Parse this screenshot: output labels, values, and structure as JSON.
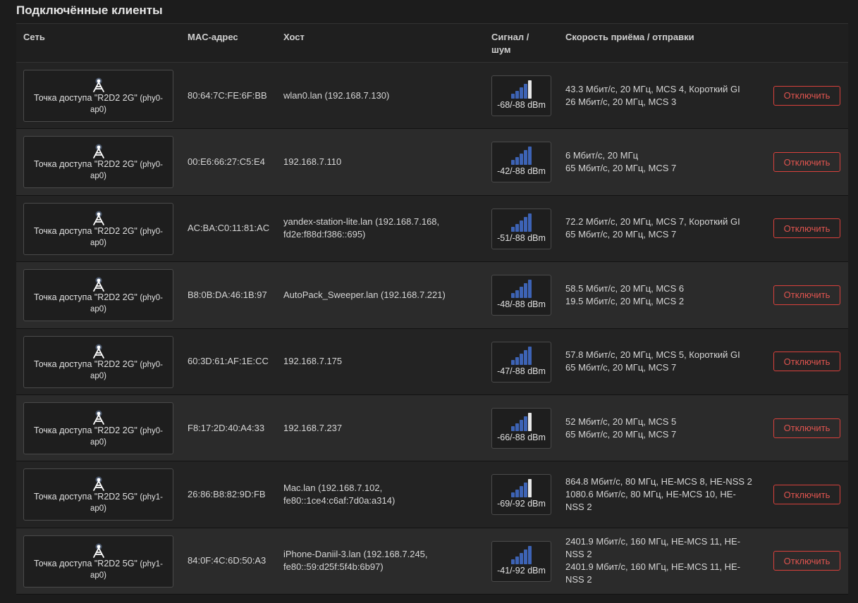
{
  "title": "Подключённые клиенты",
  "columns": {
    "network": "Сеть",
    "mac": "MAC-адрес",
    "host": "Хост",
    "signal_line1": "Сигнал /",
    "signal_line2": "шум",
    "rate": "Скорость приёма / отправки"
  },
  "colors": {
    "accent": "#d9413c",
    "signal_bar": "#3d63b5",
    "signal_bar_inactive": "#e8e8e8"
  },
  "rows": [
    {
      "net_line1": "Точка доступа \"R2D2 2G\"",
      "net_iface_a": "(phy0-",
      "net_iface_b": "ap0)",
      "mac": "80:64:7C:FE:6F:BB",
      "host_line1": "wlan0.lan (192.168.7.130)",
      "host_line2": "",
      "signal_bars_filled": 3,
      "signal": "-68/-88 dBm",
      "rate_line1": "43.3 Мбит/с, 20 МГц, MCS 4, Короткий GI",
      "rate_line2": "26 Мбит/с, 20 МГц, MCS 3",
      "rate_line3": "",
      "rate_line4": "",
      "button": "Отключить"
    },
    {
      "net_line1": "Точка доступа \"R2D2 2G\"",
      "net_iface_a": "(phy0-",
      "net_iface_b": "ap0)",
      "mac": "00:E6:66:27:C5:E4",
      "host_line1": "192.168.7.110",
      "host_line2": "",
      "signal_bars_filled": 4,
      "signal": "-42/-88 dBm",
      "rate_line1": "6 Мбит/с, 20 МГц",
      "rate_line2": "65 Мбит/с, 20 МГц, MCS 7",
      "rate_line3": "",
      "rate_line4": "",
      "button": "Отключить"
    },
    {
      "net_line1": "Точка доступа \"R2D2 2G\"",
      "net_iface_a": "(phy0-",
      "net_iface_b": "ap0)",
      "mac": "AC:BA:C0:11:81:AC",
      "host_line1": "yandex-station-lite.lan (192.168.7.168,",
      "host_line2": "fd2e:f88d:f386::695)",
      "signal_bars_filled": 4,
      "signal": "-51/-88 dBm",
      "rate_line1": "72.2 Мбит/с, 20 МГц, MCS 7, Короткий GI",
      "rate_line2": "65 Мбит/с, 20 МГц, MCS 7",
      "rate_line3": "",
      "rate_line4": "",
      "button": "Отключить"
    },
    {
      "net_line1": "Точка доступа \"R2D2 2G\"",
      "net_iface_a": "(phy0-",
      "net_iface_b": "ap0)",
      "mac": "B8:0B:DA:46:1B:97",
      "host_line1": "AutoPack_Sweeper.lan (192.168.7.221)",
      "host_line2": "",
      "signal_bars_filled": 4,
      "signal": "-48/-88 dBm",
      "rate_line1": "58.5 Мбит/с, 20 МГц, MCS 6",
      "rate_line2": "19.5 Мбит/с, 20 МГц, MCS 2",
      "rate_line3": "",
      "rate_line4": "",
      "button": "Отключить"
    },
    {
      "net_line1": "Точка доступа \"R2D2 2G\"",
      "net_iface_a": "(phy0-",
      "net_iface_b": "ap0)",
      "mac": "60:3D:61:AF:1E:CC",
      "host_line1": "192.168.7.175",
      "host_line2": "",
      "signal_bars_filled": 4,
      "signal": "-47/-88 dBm",
      "rate_line1": "57.8 Мбит/с, 20 МГц, MCS 5, Короткий GI",
      "rate_line2": "65 Мбит/с, 20 МГц, MCS 7",
      "rate_line3": "",
      "rate_line4": "",
      "button": "Отключить"
    },
    {
      "net_line1": "Точка доступа \"R2D2 2G\"",
      "net_iface_a": "(phy0-",
      "net_iface_b": "ap0)",
      "mac": "F8:17:2D:40:A4:33",
      "host_line1": "192.168.7.237",
      "host_line2": "",
      "signal_bars_filled": 3,
      "signal": "-66/-88 dBm",
      "rate_line1": "52 Мбит/с, 20 МГц, MCS 5",
      "rate_line2": "65 Мбит/с, 20 МГц, MCS 7",
      "rate_line3": "",
      "rate_line4": "",
      "button": "Отключить"
    },
    {
      "net_line1": "Точка доступа \"R2D2 5G\"",
      "net_iface_a": "(phy1-",
      "net_iface_b": "ap0)",
      "mac": "26:86:B8:82:9D:FB",
      "host_line1": "Mac.lan (192.168.7.102,",
      "host_line2": "fe80::1ce4:c6af:7d0a:a314)",
      "signal_bars_filled": 3,
      "signal": "-69/-92 dBm",
      "rate_line1": "864.8 Мбит/с, 80 МГц, HE-MCS 8, HE-NSS 2",
      "rate_line2": "1080.6 Мбит/с, 80 МГц, HE-MCS 10, HE-",
      "rate_line3": "NSS 2",
      "rate_line4": "",
      "button": "Отключить"
    },
    {
      "net_line1": "Точка доступа \"R2D2 5G\"",
      "net_iface_a": "(phy1-",
      "net_iface_b": "ap0)",
      "mac": "84:0F:4C:6D:50:A3",
      "host_line1": "iPhone-Daniil-3.lan (192.168.7.245,",
      "host_line2": "fe80::59:d25f:5f4b:6b97)",
      "signal_bars_filled": 4,
      "signal": "-41/-92 dBm",
      "rate_line1": "2401.9 Мбит/с, 160 МГц, HE-MCS 11, HE-",
      "rate_line2": "NSS 2",
      "rate_line3": "2401.9 Мбит/с, 160 МГц, HE-MCS 11, HE-",
      "rate_line4": "NSS 2",
      "button": "Отключить"
    }
  ]
}
